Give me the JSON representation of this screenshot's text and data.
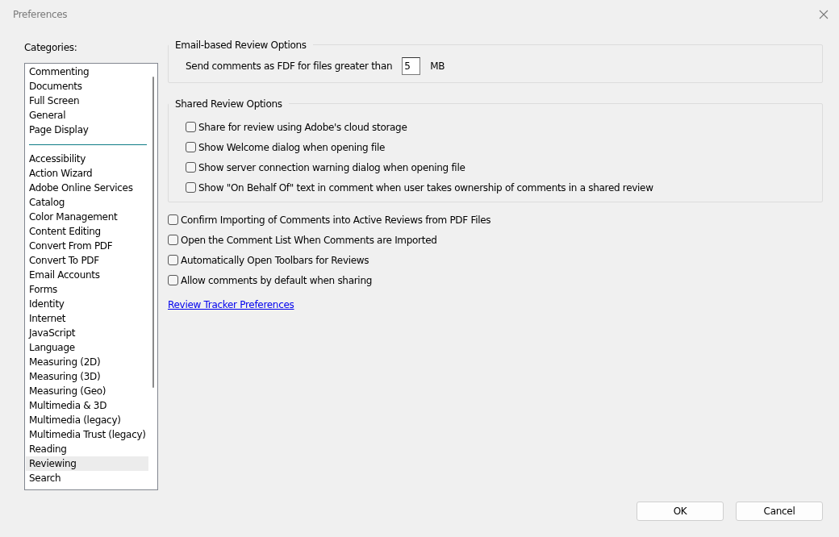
{
  "window": {
    "title": "Preferences"
  },
  "categories": {
    "label": "Categories:",
    "groups": [
      [
        {
          "label": "Commenting",
          "selected": false
        },
        {
          "label": "Documents",
          "selected": false
        },
        {
          "label": "Full Screen",
          "selected": false
        },
        {
          "label": "General",
          "selected": false
        },
        {
          "label": "Page Display",
          "selected": false
        }
      ],
      [
        {
          "label": "Accessibility",
          "selected": false
        },
        {
          "label": "Action Wizard",
          "selected": false
        },
        {
          "label": "Adobe Online Services",
          "selected": false
        },
        {
          "label": "Catalog",
          "selected": false
        },
        {
          "label": "Color Management",
          "selected": false
        },
        {
          "label": "Content Editing",
          "selected": false
        },
        {
          "label": "Convert From PDF",
          "selected": false
        },
        {
          "label": "Convert To PDF",
          "selected": false
        },
        {
          "label": "Email Accounts",
          "selected": false
        },
        {
          "label": "Forms",
          "selected": false
        },
        {
          "label": "Identity",
          "selected": false
        },
        {
          "label": "Internet",
          "selected": false
        },
        {
          "label": "JavaScript",
          "selected": false
        },
        {
          "label": "Language",
          "selected": false
        },
        {
          "label": "Measuring (2D)",
          "selected": false
        },
        {
          "label": "Measuring (3D)",
          "selected": false
        },
        {
          "label": "Measuring (Geo)",
          "selected": false
        },
        {
          "label": "Multimedia & 3D",
          "selected": false
        },
        {
          "label": "Multimedia (legacy)",
          "selected": false
        },
        {
          "label": "Multimedia Trust (legacy)",
          "selected": false
        },
        {
          "label": "Reading",
          "selected": false
        },
        {
          "label": "Reviewing",
          "selected": true
        },
        {
          "label": "Search",
          "selected": false
        }
      ]
    ]
  },
  "email_group": {
    "title": "Email-based Review Options",
    "label": "Send comments as FDF for files greater than",
    "value": "5",
    "unit": "MB"
  },
  "shared_group": {
    "title": "Shared Review Options",
    "options": [
      {
        "label": "Share for review using Adobe's cloud storage",
        "checked": false
      },
      {
        "label": "Show Welcome dialog when opening file",
        "checked": false
      },
      {
        "label": "Show server connection warning dialog when opening file",
        "checked": false
      },
      {
        "label": "Show \"On Behalf Of\" text in comment when user takes ownership of comments in a shared review",
        "checked": false
      }
    ]
  },
  "options": [
    {
      "label": "Confirm Importing of Comments into Active Reviews from PDF Files",
      "checked": false
    },
    {
      "label": "Open the Comment List When Comments are Imported",
      "checked": false
    },
    {
      "label": "Automatically Open Toolbars for Reviews",
      "checked": false
    },
    {
      "label": "Allow comments by default when sharing",
      "checked": false
    }
  ],
  "link": "Review Tracker Preferences",
  "buttons": [
    "OK",
    "Cancel"
  ]
}
